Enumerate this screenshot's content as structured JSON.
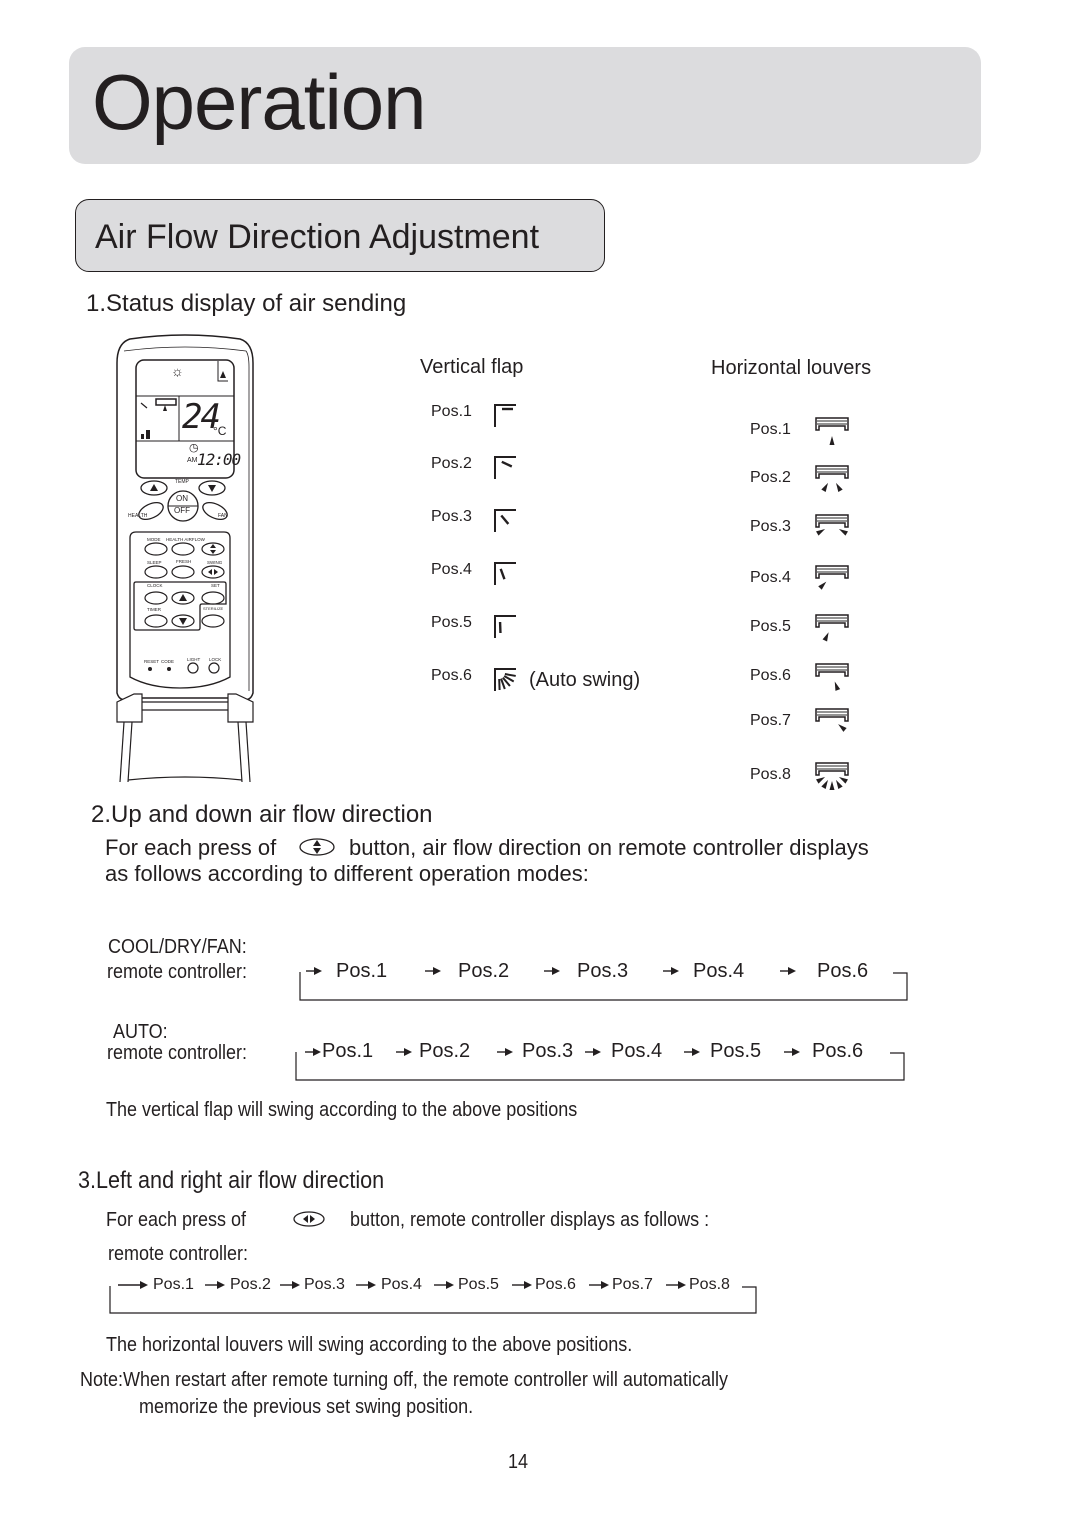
{
  "header": {
    "title": "Operation"
  },
  "section": {
    "title": "Air Flow Direction Adjustment"
  },
  "part1": {
    "heading": "1.Status display of air sending",
    "remote": {
      "lcd": {
        "temperature": "24",
        "unit": "°C",
        "time_prefix": "AM",
        "time": "12:00"
      },
      "buttons": {
        "temp": "TEMP",
        "on": "ON",
        "off": "OFF",
        "health": "HEALTH",
        "fan": "FAN",
        "mode": "MODE",
        "health_airflow": "HEALTH AIRFLOW",
        "sleep": "SLEEP",
        "fresh": "FRESH",
        "swing": "SWING",
        "clock": "CLOCK",
        "set": "SET",
        "timer": "TIMER",
        "sterilize": "STERILIZE",
        "reset": "RESET",
        "code": "CODE",
        "light": "LIGHT",
        "lock": "LOCK"
      }
    },
    "vertical_flap": {
      "title": "Vertical flap",
      "positions": [
        {
          "label": "Pos.1",
          "icon": "flap-pos1-icon"
        },
        {
          "label": "Pos.2",
          "icon": "flap-pos2-icon"
        },
        {
          "label": "Pos.3",
          "icon": "flap-pos3-icon"
        },
        {
          "label": "Pos.4",
          "icon": "flap-pos4-icon"
        },
        {
          "label": "Pos.5",
          "icon": "flap-pos5-icon"
        },
        {
          "label": "Pos.6",
          "icon": "flap-auto-swing-icon",
          "note": "(Auto swing)"
        }
      ]
    },
    "horizontal_louvers": {
      "title": "Horizontal louvers",
      "positions": [
        {
          "label": "Pos.1",
          "icon": "louver-pos1-icon"
        },
        {
          "label": "Pos.2",
          "icon": "louver-pos2-icon"
        },
        {
          "label": "Pos.3",
          "icon": "louver-pos3-icon"
        },
        {
          "label": "Pos.4",
          "icon": "louver-pos4-icon"
        },
        {
          "label": "Pos.5",
          "icon": "louver-pos5-icon"
        },
        {
          "label": "Pos.6",
          "icon": "louver-pos6-icon"
        },
        {
          "label": "Pos.7",
          "icon": "louver-pos7-icon"
        },
        {
          "label": "Pos.8",
          "icon": "louver-pos8-icon"
        }
      ]
    }
  },
  "part2": {
    "heading": "2.Up and down air flow direction",
    "intro_before": "For each press of",
    "intro_after": "button, air flow direction on remote controller displays",
    "intro_line2": "as follows according to different operation modes:",
    "modes": [
      {
        "mode": "COOL/DRY/FAN:",
        "label": "remote controller:",
        "sequence": [
          "Pos.1",
          "Pos.2",
          "Pos.3",
          "Pos.4",
          "Pos.6"
        ]
      },
      {
        "mode": "AUTO:",
        "label": "remote controller:",
        "sequence": [
          "Pos.1",
          "Pos.2",
          "Pos.3",
          "Pos.4",
          "Pos.5",
          "Pos.6"
        ]
      }
    ],
    "footer": "The vertical flap will swing according to the above positions"
  },
  "part3": {
    "heading": "3.Left and right air flow direction",
    "intro_before": "For each press of",
    "intro_after": "button, remote controller displays as follows :",
    "label": "remote controller:",
    "sequence": [
      "Pos.1",
      "Pos.2",
      "Pos.3",
      "Pos.4",
      "Pos.5",
      "Pos.6",
      "Pos.7",
      "Pos.8"
    ],
    "footer": "The horizontal louvers will swing according to the above positions.",
    "note_line1": "Note:When restart after remote turning off, the remote controller will automatically",
    "note_line2": "memorize the previous set swing position."
  },
  "page_number": "14"
}
